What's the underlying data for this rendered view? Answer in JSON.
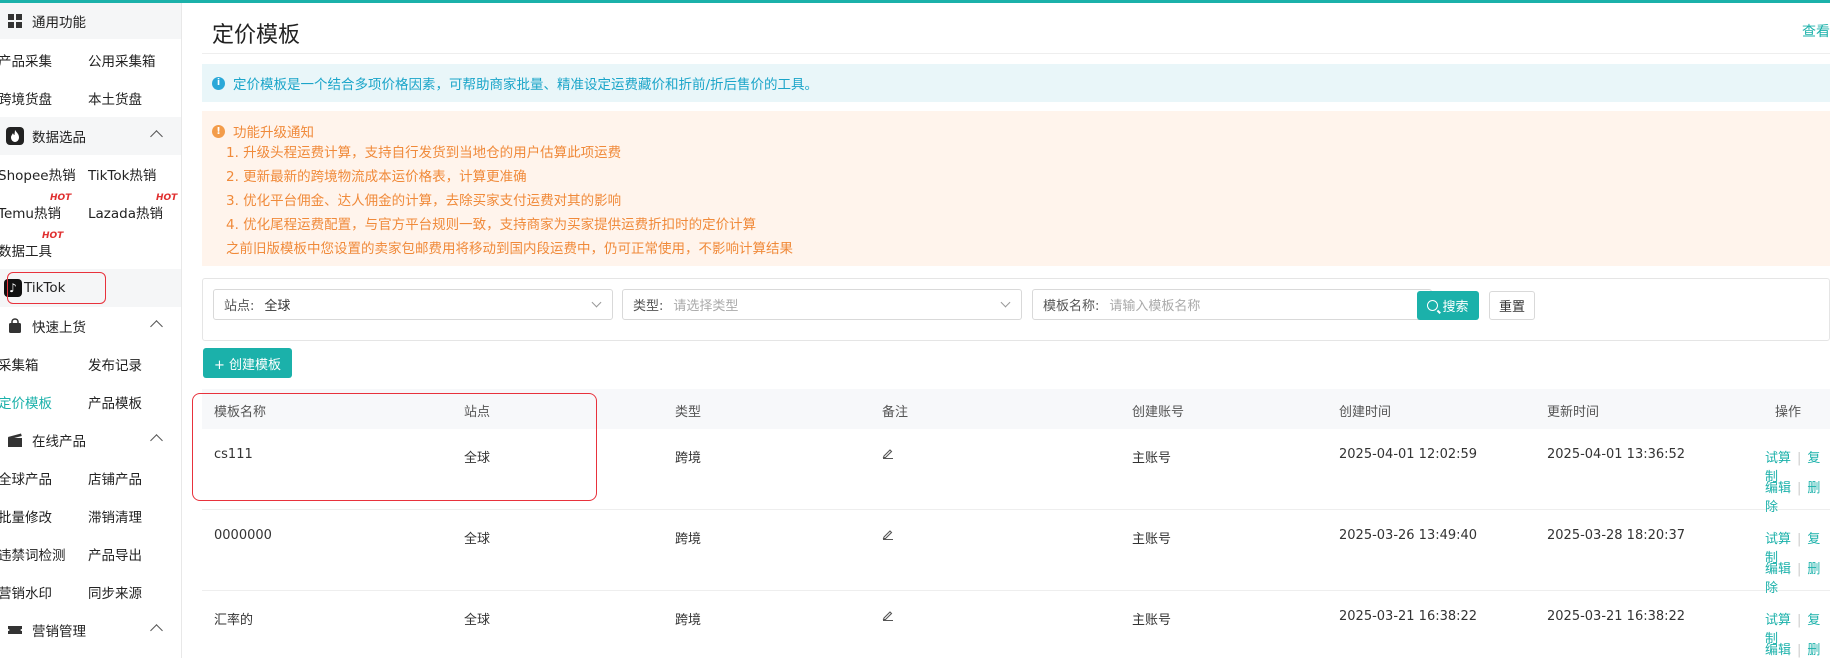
{
  "sidebar": {
    "group_general": "通用功能",
    "row1": [
      "产品采集",
      "公用采集箱"
    ],
    "row2": [
      "跨境货盘",
      "本土货盘"
    ],
    "group_data": "数据选品",
    "row3": [
      "Shopee热销",
      "TikTok热销"
    ],
    "row4": [
      "Temu热销",
      "Lazada热销"
    ],
    "row5": [
      "数据工具"
    ],
    "hot": "HOT",
    "tiktok": "TikTok",
    "group_publish": "快速上货",
    "row6": [
      "采集箱",
      "发布记录"
    ],
    "row7": [
      "定价模板",
      "产品模板"
    ],
    "group_online": "在线产品",
    "row8": [
      "全球产品",
      "店铺产品"
    ],
    "row9": [
      "批量修改",
      "滞销清理"
    ],
    "row10": [
      "违禁词检测",
      "产品导出"
    ],
    "row11": [
      "营销水印",
      "同步来源"
    ],
    "group_marketing": "营销管理"
  },
  "header": {
    "title": "定价模板",
    "top_link": "查看"
  },
  "info": "定价模板是一个结合多项价格因素，可帮助商家批量、精准设定运费藏价和折前/折后售价的工具。",
  "notice": {
    "title": "功能升级通知",
    "lines": [
      "1. 升级头程运费计算，支持自行发货到当地仓的用户估算此项运费",
      "2. 更新最新的跨境物流成本运价格表，计算更准确",
      "3. 优化平台佣金、达人佣金的计算，去除买家支付运费对其的影响",
      "4. 优化尾程运费配置，与官方平台规则一致，支持商家为买家提供运费折扣时的定价计算",
      "之前旧版模板中您设置的卖家包邮费用将移动到国内段运费中，仍可正常使用，不影响计算结果"
    ]
  },
  "filters": {
    "site_label": "站点:",
    "site_value": "全球",
    "type_label": "类型:",
    "type_placeholder": "请选择类型",
    "name_label": "模板名称:",
    "name_placeholder": "请输入模板名称",
    "search_btn": "搜索",
    "reset_btn": "重置"
  },
  "create_btn": "+ 创建模板",
  "table": {
    "headers": [
      "模板名称",
      "站点",
      "类型",
      "备注",
      "创建账号",
      "创建时间",
      "更新时间",
      "操作"
    ],
    "rows": [
      {
        "name": "cs111",
        "site": "全球",
        "type": "跨境",
        "account": "主账号",
        "created": "2025-04-01 12:02:59",
        "updated": "2025-04-01 13:36:52"
      },
      {
        "name": "0000000",
        "site": "全球",
        "type": "跨境",
        "account": "主账号",
        "created": "2025-03-26 13:49:40",
        "updated": "2025-03-28 18:20:37"
      },
      {
        "name": "汇率的",
        "site": "全球",
        "type": "跨境",
        "account": "主账号",
        "created": "2025-03-21 16:38:22",
        "updated": "2025-03-21 16:38:22"
      }
    ],
    "ops": {
      "trial": "试算",
      "copy": "复制",
      "edit": "编辑",
      "delete": "删除"
    }
  }
}
